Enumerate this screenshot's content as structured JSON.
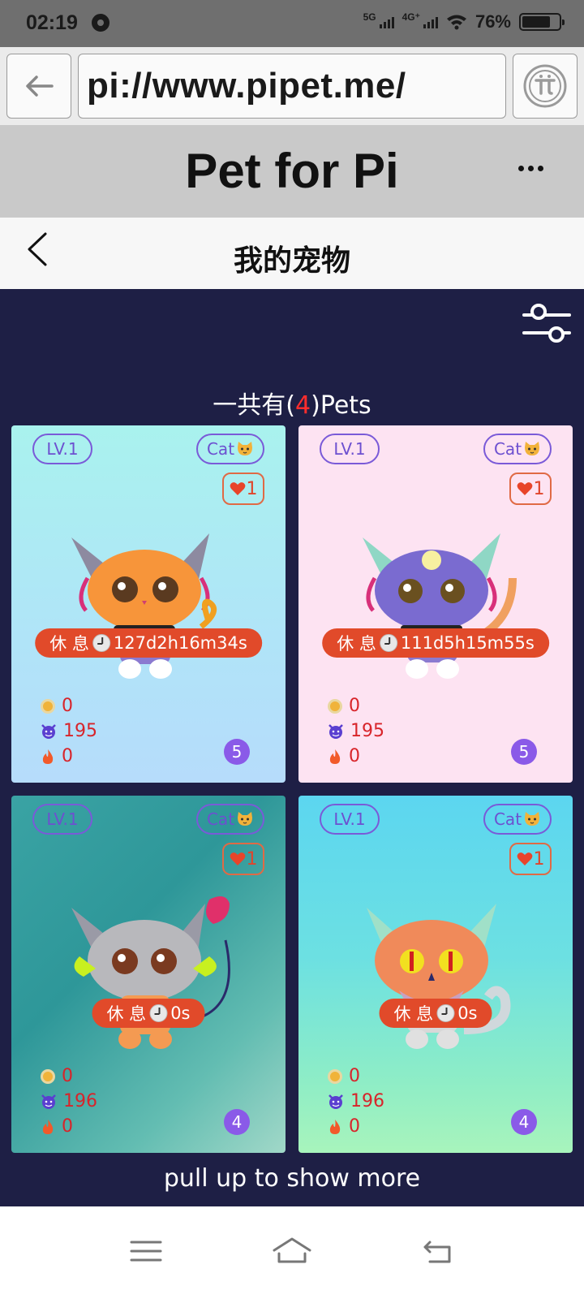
{
  "status_bar": {
    "time": "02:19",
    "network_1": "5G",
    "network_2": "4G⁺",
    "battery_text": "76%"
  },
  "browser": {
    "url": "pi://www.pipet.me/"
  },
  "app": {
    "title": "Pet for Pi"
  },
  "page": {
    "title": "我的宠物"
  },
  "summary": {
    "prefix": "一共有(",
    "count": "4",
    "suffix": ")Pets"
  },
  "colors": {
    "background": "#1e1f45",
    "accent_purple": "#7a5ad8",
    "rest_red": "#e14a2a",
    "stat_red": "#d8242a"
  },
  "pets": [
    {
      "level": "LV.1",
      "type": "Cat",
      "likes": "1",
      "rest_label": "休 息",
      "rest_time": "127d2h16m34s",
      "coins": "0",
      "power": "195",
      "fire": "0",
      "badge": "5"
    },
    {
      "level": "LV.1",
      "type": "Cat",
      "likes": "1",
      "rest_label": "休 息",
      "rest_time": "111d5h15m55s",
      "coins": "0",
      "power": "195",
      "fire": "0",
      "badge": "5"
    },
    {
      "level": "LV.1",
      "type": "Cat",
      "likes": "1",
      "rest_label": "休 息",
      "rest_time": "0s",
      "coins": "0",
      "power": "196",
      "fire": "0",
      "badge": "4"
    },
    {
      "level": "LV.1",
      "type": "Cat",
      "likes": "1",
      "rest_label": "休 息",
      "rest_time": "0s",
      "coins": "0",
      "power": "196",
      "fire": "0",
      "badge": "4"
    }
  ],
  "footer": {
    "pull_more": "pull up to show more"
  }
}
